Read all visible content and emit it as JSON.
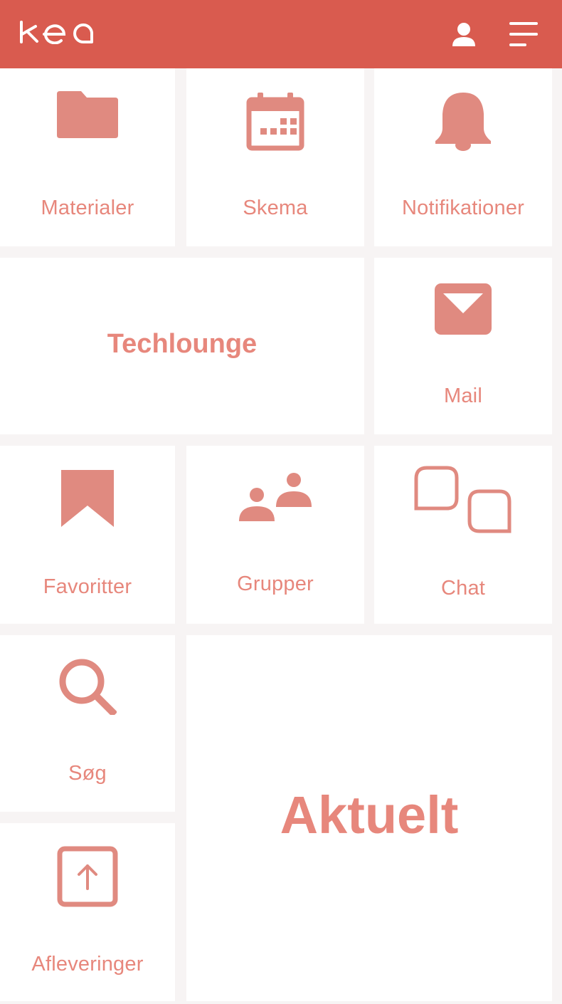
{
  "header": {
    "logo_text": "kea",
    "brand_color": "#d95b4f",
    "profile_icon": "person-icon",
    "menu_icon": "hamburger-menu-icon"
  },
  "tiles": {
    "materialer": {
      "label": "Materialer",
      "icon": "folder-icon"
    },
    "skema": {
      "label": "Skema",
      "icon": "calendar-icon"
    },
    "notifikationer": {
      "label": "Notifikationer",
      "icon": "bell-icon"
    },
    "techlounge": {
      "label": "Techlounge"
    },
    "mail": {
      "label": "Mail",
      "icon": "envelope-icon"
    },
    "favoritter": {
      "label": "Favoritter",
      "icon": "bookmark-icon"
    },
    "grupper": {
      "label": "Grupper",
      "icon": "group-icon"
    },
    "chat": {
      "label": "Chat",
      "icon": "chat-bubbles-icon"
    },
    "soeg": {
      "label": "Søg",
      "icon": "search-icon"
    },
    "afleveringer": {
      "label": "Afleveringer",
      "icon": "upload-icon"
    },
    "aktuelt": {
      "label": "Aktuelt"
    }
  },
  "colors": {
    "accent": "#e7877c",
    "tile_background": "#ffffff",
    "page_background": "#f7f4f4"
  }
}
